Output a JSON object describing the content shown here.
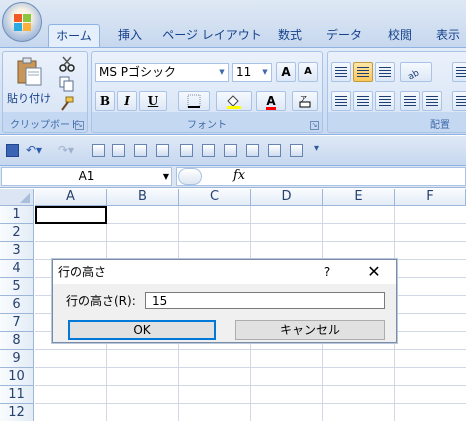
{
  "tabs": [
    {
      "label": "ホーム",
      "active": true
    },
    {
      "label": "挿入",
      "active": false
    },
    {
      "label": "ページ レイアウト",
      "active": false
    },
    {
      "label": "数式",
      "active": false
    },
    {
      "label": "データ",
      "active": false
    },
    {
      "label": "校閲",
      "active": false
    },
    {
      "label": "表示",
      "active": false
    }
  ],
  "clipboard": {
    "paste_label": "貼り付け",
    "group_label": "クリップボード"
  },
  "font": {
    "name": "MS Pゴシック",
    "size": "11",
    "group_label": "フォント",
    "bold": "B",
    "italic": "I",
    "underline": "U",
    "grow": "A",
    "shrink": "A",
    "font_color_letter": "A"
  },
  "alignment": {
    "group_label": "配置"
  },
  "formula_bar": {
    "name_box": "A1",
    "fx": "fx"
  },
  "columns": [
    "A",
    "B",
    "C",
    "D",
    "E",
    "F"
  ],
  "rows": [
    "1",
    "2",
    "3",
    "4",
    "5",
    "6",
    "7",
    "8",
    "9",
    "10",
    "11",
    "12"
  ],
  "dialog": {
    "title": "行の高さ",
    "help": "?",
    "close": "✕",
    "label": "行の高さ(R):",
    "value": "15",
    "ok_label": "OK",
    "cancel_label": "キャンセル"
  },
  "colors": {
    "accent": "#0078d7",
    "ribbon": "#c8d9f0",
    "highlight": "#fbc75a",
    "font_color_bar": "#ff0000"
  }
}
